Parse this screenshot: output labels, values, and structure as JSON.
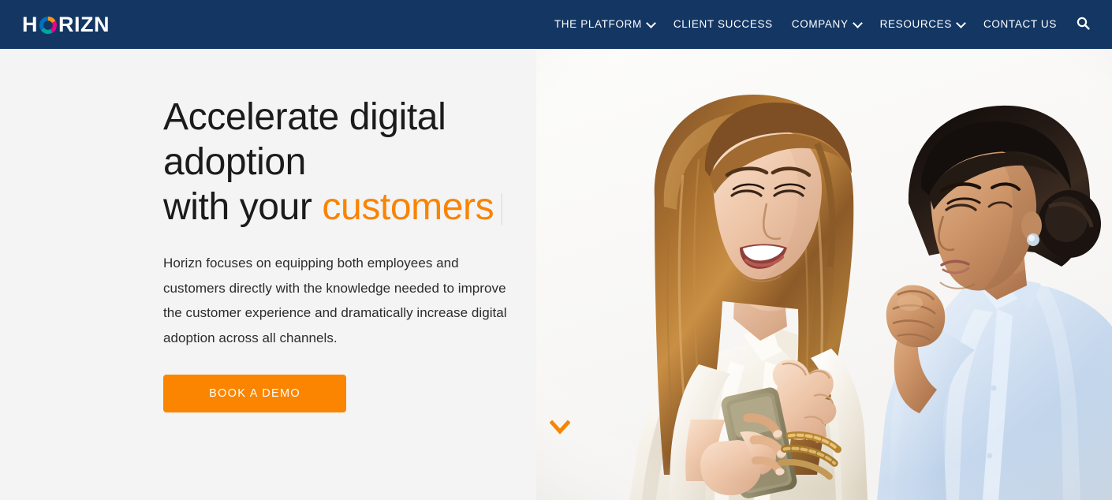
{
  "site": {
    "brand_before": "H",
    "brand_after": "RIZN",
    "brand_full": "HORIZN"
  },
  "colors": {
    "header_bg": "#133663",
    "page_bg": "#f4f4f4",
    "accent_orange": "#f98404",
    "button_orange": "#fb8500",
    "heading_text": "#1b1b1b",
    "nav_text": "#ffffff",
    "logo_ring_orange": "#f7941e",
    "logo_ring_magenta": "#ec008c",
    "logo_ring_teal": "#00a79d",
    "logo_ring_blue": "#0071bc"
  },
  "nav": {
    "items": [
      {
        "label": "THE PLATFORM",
        "has_dropdown": true,
        "icon": "chevron-down-icon"
      },
      {
        "label": "CLIENT SUCCESS",
        "has_dropdown": false,
        "icon": ""
      },
      {
        "label": "COMPANY",
        "has_dropdown": true,
        "icon": "chevron-down-icon"
      },
      {
        "label": "RESOURCES",
        "has_dropdown": true,
        "icon": "chevron-down-icon"
      },
      {
        "label": "CONTACT US",
        "has_dropdown": false,
        "icon": ""
      }
    ],
    "search_icon": "search-icon"
  },
  "hero": {
    "title_line1": "Accelerate digital adoption",
    "title_line2_prefix": "with your ",
    "title_line2_accent": "customers",
    "subtitle": "Horizn focuses on equipping both employees and customers directly with the knowledge needed to improve the customer experience and dramatically increase digital adoption across all channels.",
    "cta_label": "BOOK A DEMO",
    "scroll_icon": "chevron-down-icon",
    "photo_alt": "Two women looking at a smartphone together"
  }
}
